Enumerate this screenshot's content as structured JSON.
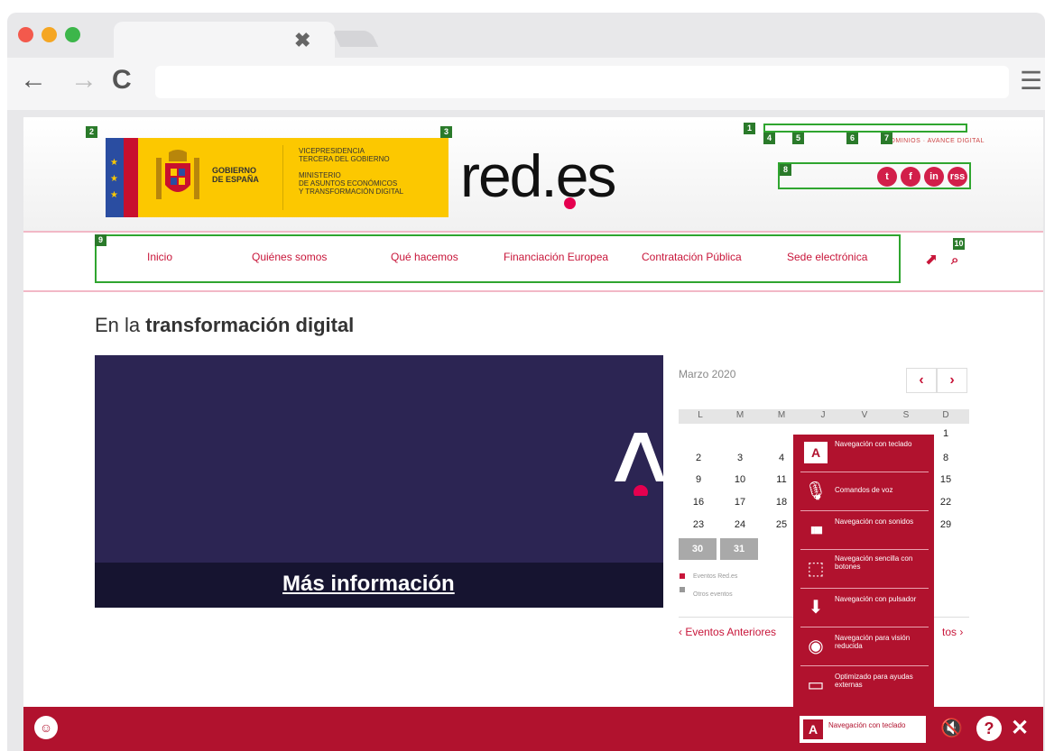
{
  "browser": {
    "tab_close": "✖",
    "back": "←",
    "forward": "→",
    "reload": "C",
    "menu": "☰"
  },
  "header": {
    "gov_name": "GOBIERNO\nDE ESPAÑA",
    "ministry": "VICEPRESIDENCIA\nTERCERA DEL GOBIERNO\n\nMINISTERIO\nDE ASUNTOS ECONÓMICOS\nY TRANSFORMACIÓN DIGITAL",
    "brand": "red.es",
    "top_links": "DOMINIOS · AVANCE DIGITAL",
    "social": [
      "t",
      "f",
      "in",
      "rss"
    ]
  },
  "badges": [
    "1",
    "2",
    "3",
    "4",
    "5",
    "6",
    "7",
    "8",
    "9",
    "10"
  ],
  "nav": {
    "items": [
      "Inicio",
      "Quiénes somos",
      "Qué hacemos",
      "Financiación Europea",
      "Contratación Pública",
      "Sede electrónica"
    ]
  },
  "main": {
    "title_prefix": "En la ",
    "title_bold": "transformación digital",
    "hero_link": "Más información"
  },
  "calendar": {
    "month": "Marzo 2020",
    "prev": "‹",
    "next": "›",
    "dow": [
      "L",
      "M",
      "M",
      "J",
      "V",
      "S",
      "D"
    ],
    "days": [
      "1",
      "2",
      "3",
      "4",
      "8",
      "9",
      "10",
      "11",
      "15",
      "16",
      "17",
      "18",
      "22",
      "23",
      "24",
      "25",
      "29",
      "30",
      "31"
    ],
    "legend": [
      "Eventos Red.es",
      "Otros eventos"
    ],
    "events_prev": "‹ Eventos Anteriores",
    "events_next": "tos ›"
  },
  "accessibility": {
    "items": [
      {
        "label": "Navegación con teclado",
        "icon": "A"
      },
      {
        "label": "Comandos de voz",
        "icon": "🎙"
      },
      {
        "label": "Navegación con sonidos",
        "icon": "▮▮▮"
      },
      {
        "label": "Navegación sencilla con botones",
        "icon": "⬚"
      },
      {
        "label": "Navegación con pulsador",
        "icon": "⬇"
      },
      {
        "label": "Navegación para visión reducida",
        "icon": "◉"
      },
      {
        "label": "Optimizado para ayudas externas",
        "icon": "▭"
      }
    ],
    "current": {
      "label": "Navegación con teclado",
      "icon": "A"
    },
    "footer_logo": "☺",
    "mute": "🔇",
    "help": "?",
    "close": "✕"
  },
  "colors": {
    "brand_red": "#b1122e",
    "accent_pink": "#e5004f",
    "annotation_green": "#2fa52f"
  }
}
